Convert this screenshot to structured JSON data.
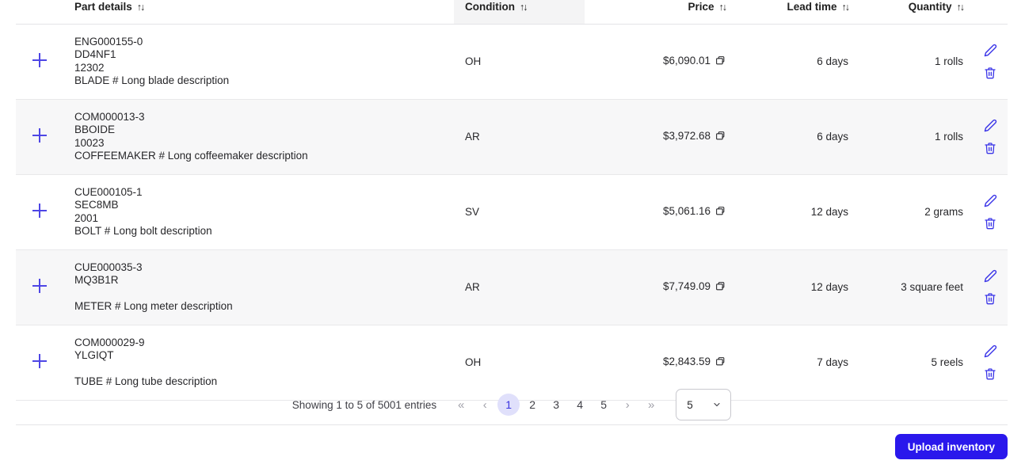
{
  "table": {
    "columns": [
      {
        "key": "expand",
        "label": "",
        "sortable": false
      },
      {
        "key": "part",
        "label": "Part details",
        "sortable": true,
        "sort_icon": "sort-icon"
      },
      {
        "key": "condition",
        "label": "Condition",
        "sortable": true,
        "sort_icon": "sort-icon",
        "highlighted": true
      },
      {
        "key": "price",
        "label": "Price",
        "sortable": true,
        "sort_icon": "sort-icon"
      },
      {
        "key": "lead_time",
        "label": "Lead time",
        "sortable": true,
        "sort_icon": "sort-icon"
      },
      {
        "key": "quantity",
        "label": "Quantity",
        "sortable": true,
        "sort_icon": "sort-icon"
      },
      {
        "key": "actions",
        "label": "",
        "sortable": false
      }
    ],
    "expand_icon": "plus-icon",
    "copy_icon": "copy-icon",
    "edit_icon": "pencil-icon",
    "delete_icon": "trash-icon",
    "rows": [
      {
        "part_number": "ENG000155-0",
        "manufacturer": "DD4NF1",
        "code": "12302",
        "description": "BLADE # Long blade description",
        "condition": "OH",
        "price": "$6,090.01",
        "lead_time": "6 days",
        "quantity": "1 rolls"
      },
      {
        "part_number": "COM000013-3",
        "manufacturer": "BBOIDE",
        "code": "10023",
        "description": "COFFEEMAKER # Long coffeemaker description",
        "condition": "AR",
        "price": "$3,972.68",
        "lead_time": "6 days",
        "quantity": "1 rolls"
      },
      {
        "part_number": "CUE000105-1",
        "manufacturer": "SEC8MB",
        "code": "2001",
        "description": "BOLT # Long bolt description",
        "condition": "SV",
        "price": "$5,061.16",
        "lead_time": "12 days",
        "quantity": "2 grams"
      },
      {
        "part_number": "CUE000035-3",
        "manufacturer": "MQ3B1R",
        "code": "",
        "description": "METER # Long meter description",
        "condition": "AR",
        "price": "$7,749.09",
        "lead_time": "12 days",
        "quantity": "3 square feet"
      },
      {
        "part_number": "COM000029-9",
        "manufacturer": "YLGIQT",
        "code": "",
        "description": "TUBE # Long tube description",
        "condition": "OH",
        "price": "$2,843.59",
        "lead_time": "7 days",
        "quantity": "5 reels"
      }
    ]
  },
  "pagination": {
    "showing_text": "Showing 1 to 5 of 5001 entries",
    "first_label": "«",
    "prev_label": "‹",
    "next_label": "›",
    "last_label": "»",
    "pages": [
      "1",
      "2",
      "3",
      "4",
      "5"
    ],
    "active_page": "1",
    "page_size": "5",
    "page_size_icon": "chevron-down-icon"
  },
  "footer": {
    "upload_label": "Upload inventory"
  },
  "colors": {
    "accent": "#2a18ec",
    "icon_blue": "#4e46e5",
    "active_page_bg": "#e0e0fb",
    "active_page_text": "#3b35e0",
    "row_alt_bg": "#f7f7f8",
    "header_highlight_bg": "#f4f4f5",
    "border": "#e4e4e7"
  }
}
